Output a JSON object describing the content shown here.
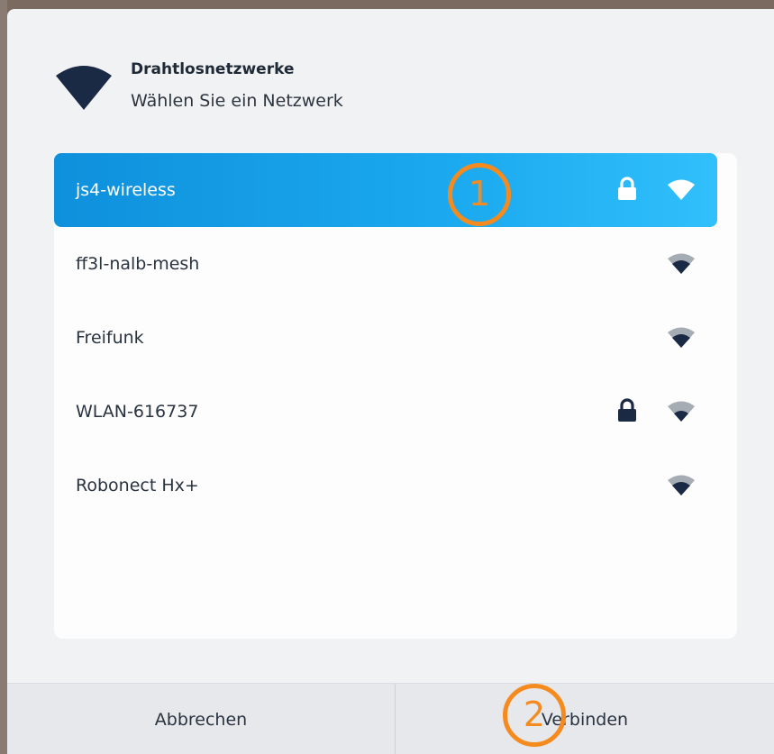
{
  "dialog": {
    "title": "Drahtlosnetzwerke",
    "subtitle": "Wählen Sie ein Netzwerk"
  },
  "networks": [
    {
      "name": "js4-wireless",
      "secured": true,
      "selected": true
    },
    {
      "name": "ff3l-nalb-mesh",
      "secured": false,
      "selected": false
    },
    {
      "name": "Freifunk",
      "secured": false,
      "selected": false
    },
    {
      "name": "WLAN-616737",
      "secured": true,
      "selected": false
    },
    {
      "name": "Robonect Hx+",
      "secured": false,
      "selected": false
    }
  ],
  "footer": {
    "cancel_label": "Abbrechen",
    "connect_label": "Verbinden"
  },
  "annotations": {
    "marker_1": "1",
    "marker_2": "2"
  },
  "colors": {
    "selected_row": "#1ba9ef",
    "marker": "#f58b1e",
    "icon_dark": "#1b2a44"
  },
  "icons": {
    "header": "wifi-icon",
    "secured": "lock-icon",
    "signal": "wifi-signal-icon"
  }
}
